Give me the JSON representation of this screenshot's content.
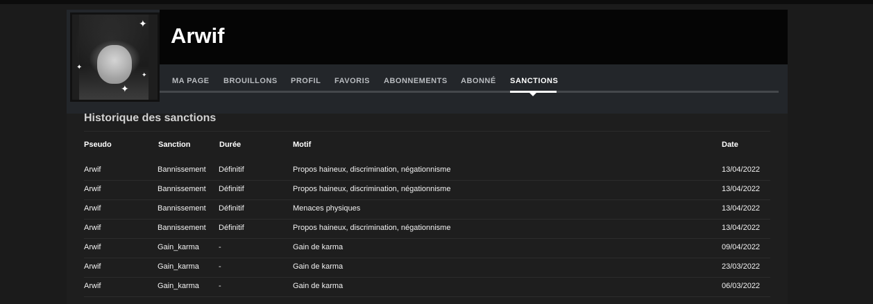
{
  "profile": {
    "username": "Arwif"
  },
  "nav": {
    "items": [
      "MA PAGE",
      "BROUILLONS",
      "PROFIL",
      "FAVORIS",
      "ABONNEMENTS",
      "ABONNÉ",
      "SANCTIONS"
    ],
    "active": "SANCTIONS"
  },
  "sanctions": {
    "title": "Historique des sanctions",
    "columns": [
      "Pseudo",
      "Sanction",
      "Durée",
      "Motif",
      "Date"
    ],
    "rows": [
      [
        "Arwif",
        "Bannissement",
        "Définitif",
        "Propos haineux, discrimination, négationnisme",
        "13/04/2022"
      ],
      [
        "Arwif",
        "Bannissement",
        "Définitif",
        "Propos haineux, discrimination, négationnisme",
        "13/04/2022"
      ],
      [
        "Arwif",
        "Bannissement",
        "Définitif",
        "Menaces physiques",
        "13/04/2022"
      ],
      [
        "Arwif",
        "Bannissement",
        "Définitif",
        "Propos haineux, discrimination, négationnisme",
        "13/04/2022"
      ],
      [
        "Arwif",
        "Gain_karma",
        "-",
        "Gain de karma",
        "09/04/2022"
      ],
      [
        "Arwif",
        "Gain_karma",
        "-",
        "Gain de karma",
        "23/03/2022"
      ],
      [
        "Arwif",
        "Gain_karma",
        "-",
        "Gain de karma",
        "06/03/2022"
      ]
    ]
  },
  "colors": {
    "background": "#1b1b1b",
    "header": "#050505",
    "nav_band": "#23262a",
    "active": "#ffffff"
  }
}
